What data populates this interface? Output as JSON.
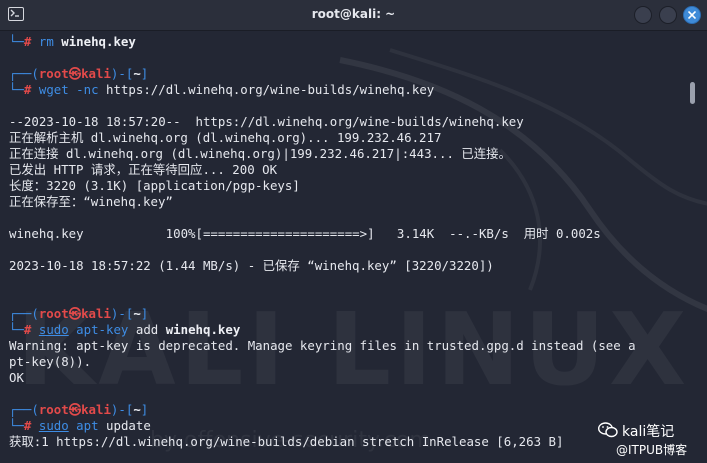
{
  "window": {
    "title": "root@kali: ~",
    "accent_color": "#3f8bd8",
    "icons": [
      "terminal-icon",
      "minimize-icon",
      "maximize-icon",
      "close-icon"
    ]
  },
  "prompt": {
    "user": "root",
    "at": "㉿",
    "host": "kali",
    "cwd": "~",
    "hash": "#"
  },
  "terminal": {
    "cmd_rm": "rm",
    "arg_rm": "winehq.key",
    "cmd_wget": "wget",
    "opt_wget": "-nc",
    "arg_wget": "https://dl.winehq.org/wine-builds/winehq.key",
    "out1": "--2023-10-18 18:57:20--  https://dl.winehq.org/wine-builds/winehq.key",
    "out2": "正在解析主机 dl.winehq.org (dl.winehq.org)... 199.232.46.217",
    "out3": "正在连接 dl.winehq.org (dl.winehq.org)|199.232.46.217|:443... 已连接。",
    "out4": "已发出 HTTP 请求，正在等待回应... 200 OK",
    "out5": "长度：3220 (3.1K) [application/pgp-keys]",
    "out6": "正在保存至：“winehq.key”",
    "progress": "winehq.key           100%[=====================>]   3.14K  --.-KB/s  用时 0.002s",
    "out7": "2023-10-18 18:57:22 (1.44 MB/s) - 已保存 “winehq.key” [3220/3220])",
    "cmd_sudo": "sudo",
    "cmd_aptkey": "apt-key",
    "arg_add": "add",
    "arg_key": "winehq.key",
    "warn1": "Warning: apt-key is deprecated. Manage keyring files in trusted.gpg.d instead (see a",
    "warn2": "pt-key(8)).",
    "ok": "OK",
    "cmd_apt": "apt",
    "arg_update": "update",
    "last": "获取:1 https://dl.winehq.org/wine-builds/debian stretch InRelease [6,263 B]"
  },
  "watermark": {
    "text": "KALI LINUX",
    "url": "by offensive-security.com"
  },
  "badge": {
    "name": "kali笔记",
    "source": "@ITPUB博客"
  }
}
